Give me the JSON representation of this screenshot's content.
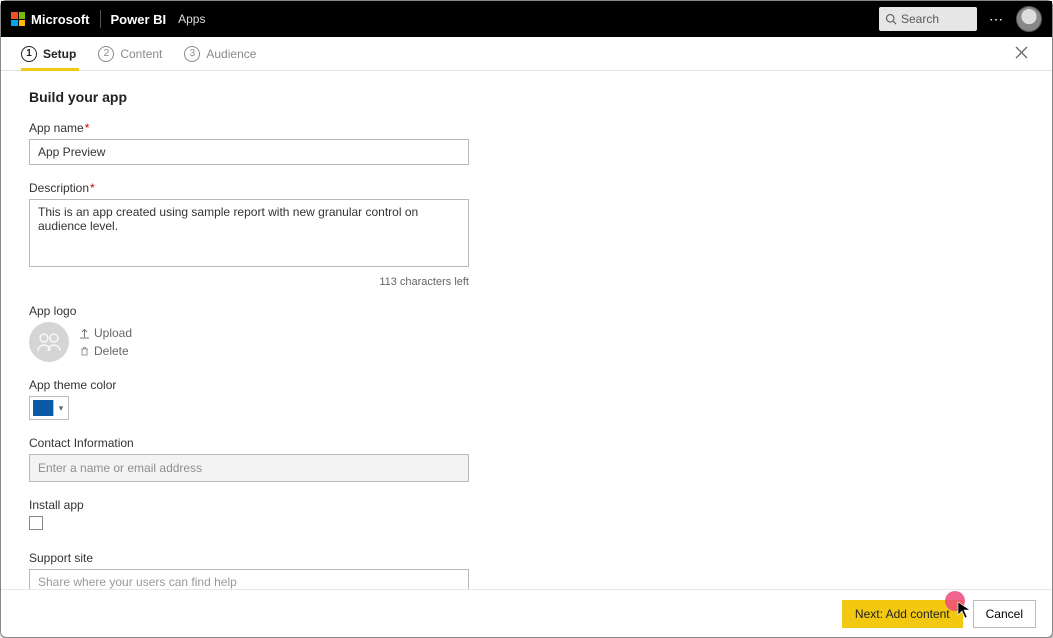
{
  "topbar": {
    "brand": "Microsoft",
    "product": "Power BI",
    "crumb": "Apps",
    "search_placeholder": "Search"
  },
  "steps": {
    "s1": {
      "num": "1",
      "label": "Setup"
    },
    "s2": {
      "num": "2",
      "label": "Content"
    },
    "s3": {
      "num": "3",
      "label": "Audience"
    }
  },
  "page": {
    "heading": "Build your app",
    "app_name_label": "App name",
    "app_name_value": "App Preview",
    "description_label": "Description",
    "description_value": "This is an app created using sample report with new granular control on audience level.",
    "char_counter": "113 characters left",
    "app_logo_label": "App logo",
    "upload_label": "Upload",
    "delete_label": "Delete",
    "theme_label": "App theme color",
    "theme_color": "#0b5aa6",
    "contact_label": "Contact Information",
    "contact_placeholder": "Enter a name or email address",
    "install_label": "Install app",
    "support_label": "Support site",
    "support_placeholder": "Share where your users can find help"
  },
  "footer": {
    "next": "Next: Add content",
    "cancel": "Cancel"
  }
}
